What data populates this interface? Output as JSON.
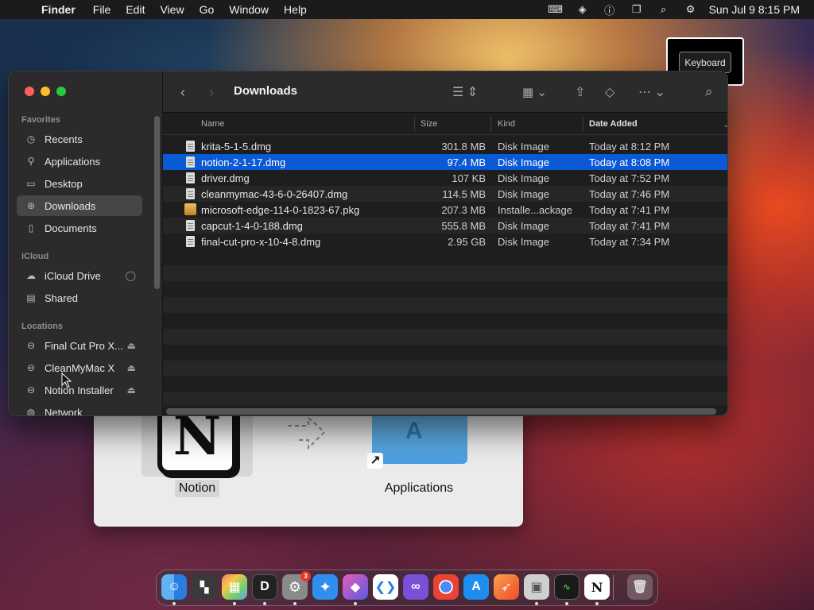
{
  "menubar": {
    "app_name": "Finder",
    "items": [
      "File",
      "Edit",
      "View",
      "Go",
      "Window",
      "Help"
    ],
    "clock": "Sun Jul 9  8:15 PM"
  },
  "tooltip": {
    "text": "Keyboard"
  },
  "finder": {
    "title": "Downloads",
    "sidebar": {
      "favorites_header": "Favorites",
      "favorites": [
        "Recents",
        "Applications",
        "Desktop",
        "Downloads",
        "Documents"
      ],
      "icloud_header": "iCloud",
      "icloud": [
        "iCloud Drive",
        "Shared"
      ],
      "locations_header": "Locations",
      "locations": [
        "Final Cut Pro X...",
        "CleanMyMac X",
        "Notion Installer",
        "Network"
      ]
    },
    "columns": {
      "name": "Name",
      "size": "Size",
      "kind": "Kind",
      "date": "Date Added"
    },
    "files": [
      {
        "name": "krita-5-1-5.dmg",
        "size": "301.8 MB",
        "kind": "Disk Image",
        "date": "Today at 8:12 PM"
      },
      {
        "name": "notion-2-1-17.dmg",
        "size": "97.4 MB",
        "kind": "Disk Image",
        "date": "Today at 8:08 PM"
      },
      {
        "name": "driver.dmg",
        "size": "107 KB",
        "kind": "Disk Image",
        "date": "Today at 7:52 PM"
      },
      {
        "name": "cleanmymac-43-6-0-26407.dmg",
        "size": "114.5 MB",
        "kind": "Disk Image",
        "date": "Today at 7:46 PM"
      },
      {
        "name": "microsoft-edge-114-0-1823-67.pkg",
        "size": "207.3 MB",
        "kind": "Installe...ackage",
        "date": "Today at 7:41 PM"
      },
      {
        "name": "capcut-1-4-0-188.dmg",
        "size": "555.8 MB",
        "kind": "Disk Image",
        "date": "Today at 7:41 PM"
      },
      {
        "name": "final-cut-pro-x-10-4-8.dmg",
        "size": "2.95 GB",
        "kind": "Disk Image",
        "date": "Today at 7:34 PM"
      }
    ]
  },
  "dmg_window": {
    "app_label": "Notion",
    "folder_label": "Applications"
  },
  "dock": {
    "settings_badge": "3",
    "apps": [
      "finder-icon",
      "file-explorer-icon",
      "launchpad-icon",
      "d-app-icon",
      "system-settings-icon",
      "safari-icon",
      "shortcuts-icon",
      "vscode-icon",
      "visual-studio-icon",
      "chrome-icon",
      "app-store-icon",
      "swift-icon",
      "installer-icon",
      "activity-monitor-icon",
      "notion-icon",
      "trash-icon"
    ]
  }
}
